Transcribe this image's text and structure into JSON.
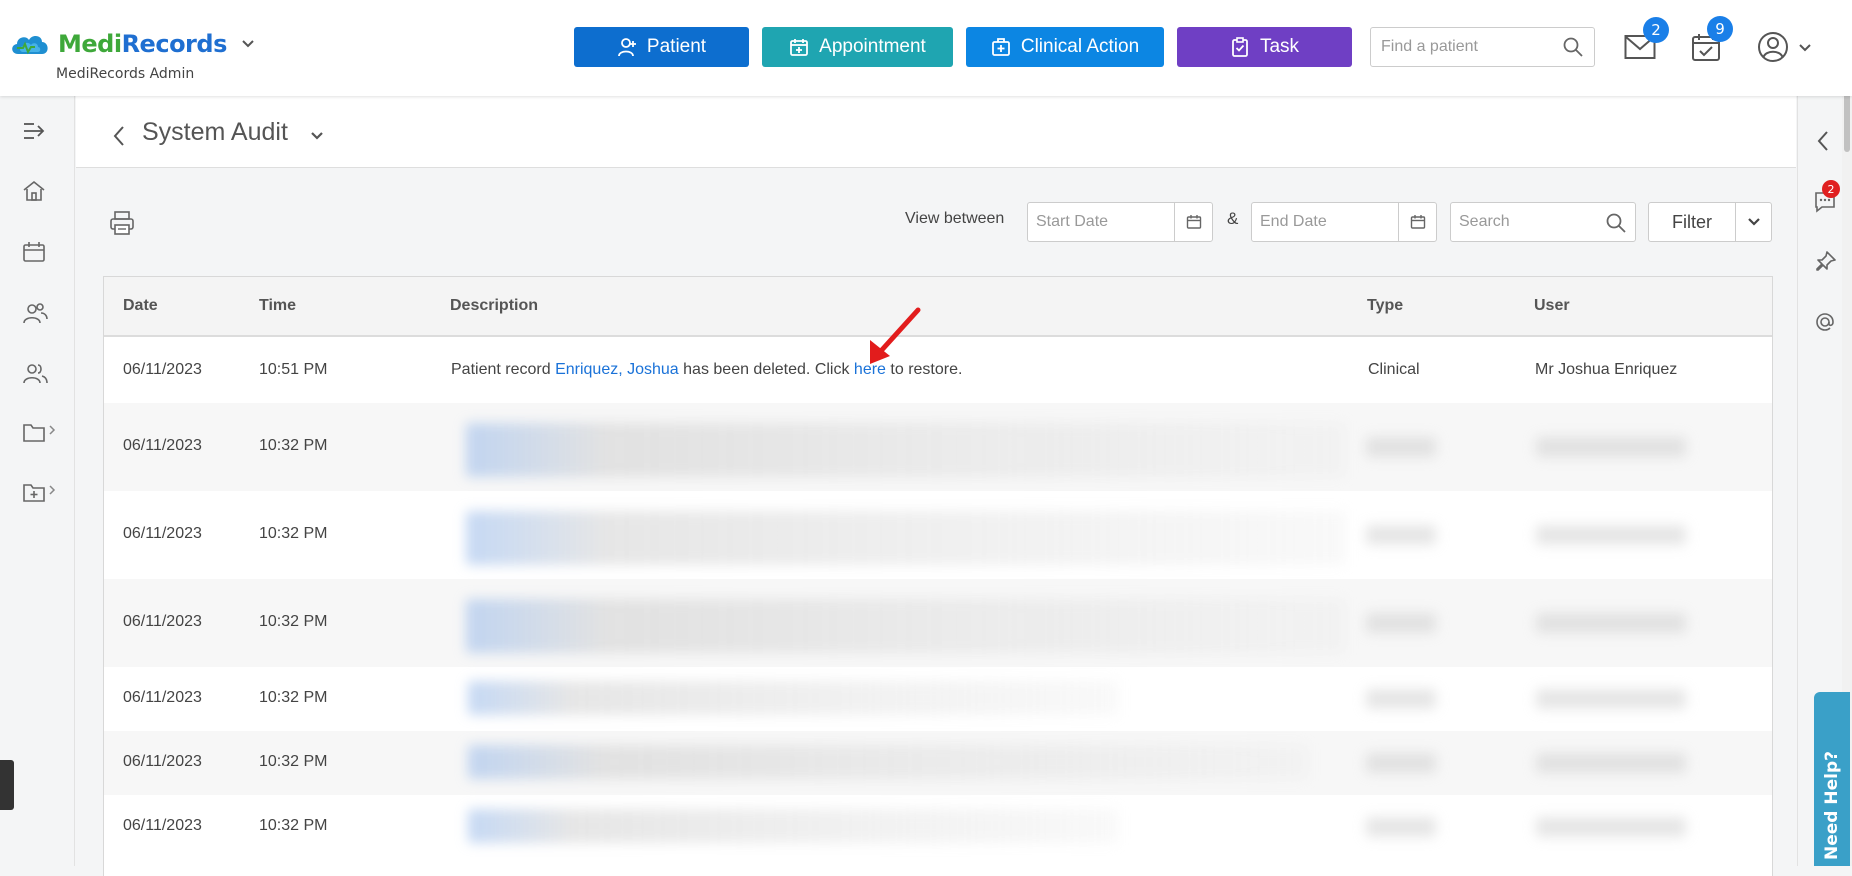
{
  "app": {
    "logo_medi": "Medi",
    "logo_records": "Records",
    "subtitle": "MediRecords Admin",
    "brand_colors": {
      "green": "#3ea83a",
      "blue": "#1f6fd1"
    }
  },
  "topbar": {
    "buttons": {
      "patient": "Patient",
      "appointment": "Appointment",
      "clinical_action": "Clinical Action",
      "task": "Task"
    },
    "button_colors": {
      "patient": "#0d6ecf",
      "appointment": "#1fa5b1",
      "clinical_action": "#0c86e3",
      "task": "#6f3fc4"
    },
    "find_patient_placeholder": "Find a patient",
    "mail_count": "2",
    "calendar_count": "9"
  },
  "page": {
    "title": "System Audit"
  },
  "toolbar": {
    "view_between_label": "View between",
    "start_date_placeholder": "Start Date",
    "amp": "&",
    "end_date_placeholder": "End Date",
    "search_placeholder": "Search",
    "filter_label": "Filter"
  },
  "table": {
    "headers": {
      "date": "Date",
      "time": "Time",
      "description": "Description",
      "type": "Type",
      "user": "User"
    },
    "first_row": {
      "date": "06/11/2023",
      "time": "10:51 PM",
      "desc_prefix": "Patient record ",
      "desc_patient_link": "Enriquez, Joshua",
      "desc_middle": " has been deleted. Click ",
      "desc_here_link": "here",
      "desc_suffix": " to restore.",
      "type": "Clinical",
      "user": "Mr Joshua Enriquez"
    },
    "blurred_rows": [
      {
        "date": "06/11/2023",
        "time": "10:32 PM"
      },
      {
        "date": "06/11/2023",
        "time": "10:32 PM"
      },
      {
        "date": "06/11/2023",
        "time": "10:32 PM"
      },
      {
        "date": "06/11/2023",
        "time": "10:32 PM"
      },
      {
        "date": "06/11/2023",
        "time": "10:32 PM"
      },
      {
        "date": "06/11/2023",
        "time": "10:32 PM"
      }
    ]
  },
  "right_panel": {
    "chat_badge": "2",
    "help_label": "Need Help?"
  }
}
